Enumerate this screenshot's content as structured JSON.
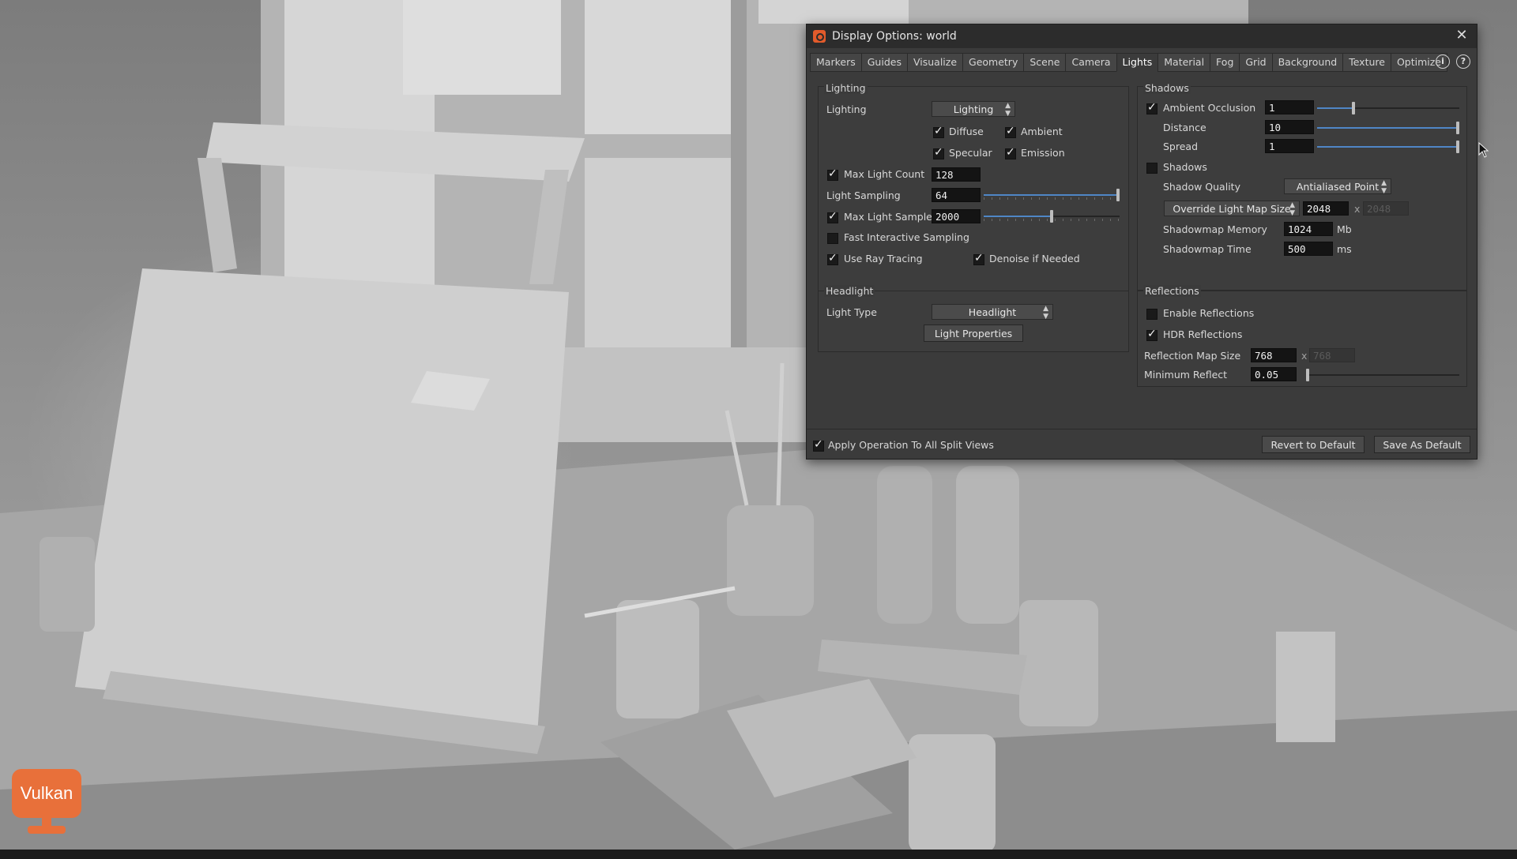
{
  "window": {
    "title": "Display Options:  world"
  },
  "tabs": [
    {
      "label": "Markers"
    },
    {
      "label": "Guides"
    },
    {
      "label": "Visualize"
    },
    {
      "label": "Geometry"
    },
    {
      "label": "Scene"
    },
    {
      "label": "Camera"
    },
    {
      "label": "Lights",
      "active": true
    },
    {
      "label": "Material"
    },
    {
      "label": "Fog"
    },
    {
      "label": "Grid"
    },
    {
      "label": "Background"
    },
    {
      "label": "Texture"
    },
    {
      "label": "Optimize"
    }
  ],
  "lighting": {
    "group_title": "Lighting",
    "lighting_label": "Lighting",
    "lighting_mode": "Lighting",
    "diffuse": {
      "label": "Diffuse",
      "checked": true
    },
    "ambient": {
      "label": "Ambient",
      "checked": true
    },
    "specular": {
      "label": "Specular",
      "checked": true
    },
    "emission": {
      "label": "Emission",
      "checked": true
    },
    "max_light_count": {
      "label": "Max Light Count",
      "value": "128",
      "checked": true
    },
    "light_sampling": {
      "label": "Light Sampling",
      "value": "64",
      "slider": 1.0
    },
    "max_light_samples": {
      "label": "Max Light Samples",
      "value": "2000",
      "checked": true,
      "slider": 0.5
    },
    "fast_interactive_sampling": {
      "label": "Fast Interactive Sampling",
      "checked": false
    },
    "use_ray_tracing": {
      "label": "Use Ray Tracing",
      "checked": true
    },
    "denoise_if_needed": {
      "label": "Denoise if Needed",
      "checked": true
    }
  },
  "headlight": {
    "group_title": "Headlight",
    "light_type_label": "Light Type",
    "light_type": "Headlight",
    "light_properties_button": "Light Properties"
  },
  "shadows": {
    "group_title": "Shadows",
    "ambient_occlusion": {
      "label": "Ambient Occlusion",
      "value": "1",
      "checked": true,
      "slider": 0.25
    },
    "distance": {
      "label": "Distance",
      "value": "10",
      "slider": 1.0
    },
    "spread": {
      "label": "Spread",
      "value": "1",
      "slider": 1.0
    },
    "shadows": {
      "label": "Shadows",
      "checked": false
    },
    "shadow_quality": {
      "label": "Shadow Quality",
      "value": "Antialiased Point"
    },
    "override_light_map_size": {
      "label": "Override Light Map Size",
      "value": "2048",
      "separator": "x",
      "value2": "2048"
    },
    "shadowmap_memory": {
      "label": "Shadowmap Memory",
      "value": "1024",
      "unit": "Mb"
    },
    "shadowmap_time": {
      "label": "Shadowmap Time",
      "value": "500",
      "unit": "ms"
    }
  },
  "reflections": {
    "group_title": "Reflections",
    "enable_reflections": {
      "label": "Enable Reflections",
      "checked": false
    },
    "hdr_reflections": {
      "label": "HDR Reflections",
      "checked": true
    },
    "reflection_map_size": {
      "label": "Reflection Map Size",
      "value": "768",
      "separator": "x",
      "value2": "768"
    },
    "minimum_reflect": {
      "label": "Minimum Reflect",
      "value": "0.05",
      "slider": 0.0
    }
  },
  "footer": {
    "apply_all": {
      "label": "Apply Operation To All Split Views",
      "checked": true
    },
    "revert_button": "Revert to Default",
    "save_button": "Save As Default"
  },
  "badge": {
    "label": "Vulkan"
  },
  "colors": {
    "accent": "#4f86c6",
    "dialog_bg": "#3b3b3b",
    "badge": "#e8703a",
    "app_icon": "#e35b2b"
  },
  "icons": {
    "info": "i",
    "help": "?",
    "close": "✕",
    "dropdown": "▲▼"
  }
}
